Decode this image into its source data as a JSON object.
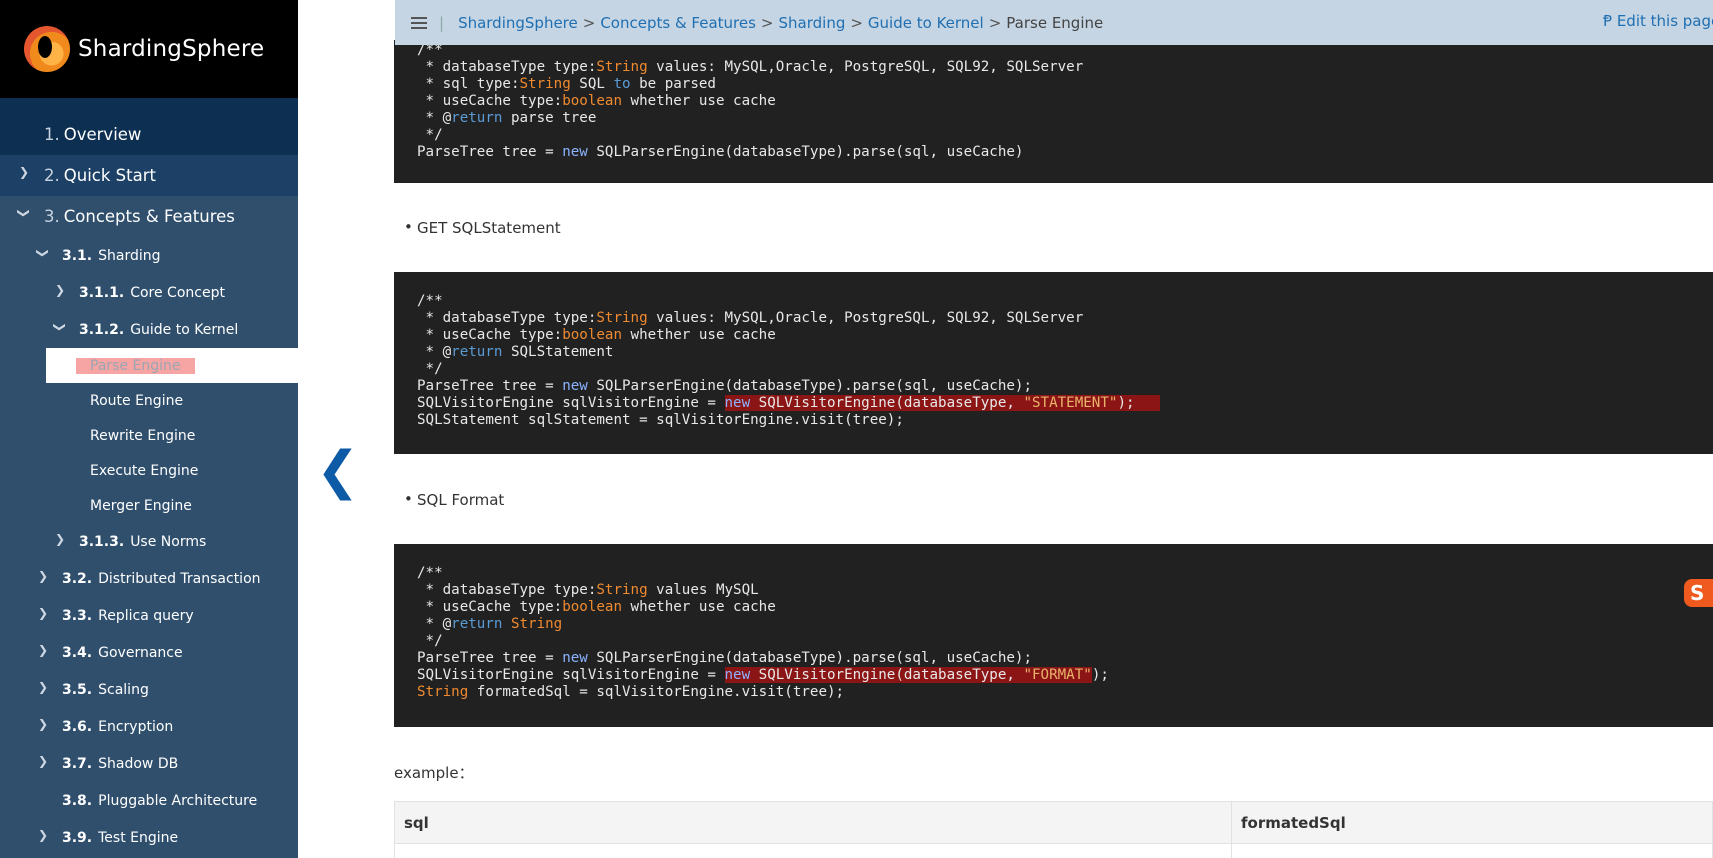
{
  "brand": {
    "name": "ShardingSphere"
  },
  "sidebar": {
    "items": [
      {
        "num": "1.",
        "label": "Overview"
      },
      {
        "num": "2.",
        "label": "Quick Start"
      },
      {
        "num": "3.",
        "label": "Concepts & Features"
      },
      {
        "num": "3.1.",
        "label": "Sharding"
      },
      {
        "num": "3.1.1.",
        "label": "Core Concept"
      },
      {
        "num": "3.1.2.",
        "label": "Guide to Kernel"
      },
      {
        "label": "Parse Engine"
      },
      {
        "label": "Route Engine"
      },
      {
        "label": "Rewrite Engine"
      },
      {
        "label": "Execute Engine"
      },
      {
        "label": "Merger Engine"
      },
      {
        "num": "3.1.3.",
        "label": "Use Norms"
      },
      {
        "num": "3.2.",
        "label": "Distributed Transaction"
      },
      {
        "num": "3.3.",
        "label": "Replica query"
      },
      {
        "num": "3.4.",
        "label": "Governance"
      },
      {
        "num": "3.5.",
        "label": "Scaling"
      },
      {
        "num": "3.6.",
        "label": "Encryption"
      },
      {
        "num": "3.7.",
        "label": "Shadow DB"
      },
      {
        "num": "3.8.",
        "label": "Pluggable Architecture"
      },
      {
        "num": "3.9.",
        "label": "Test Engine"
      }
    ]
  },
  "breadcrumb": {
    "items": [
      "ShardingSphere",
      "Concepts & Features",
      "Sharding",
      "Guide to Kernel"
    ],
    "separator": ">",
    "current": "Parse Engine"
  },
  "edit_link": "Edit this page",
  "bullets": [
    "GET SQLStatement",
    "SQL Format"
  ],
  "code_blocks": {
    "block1": {
      "l0": "/**",
      "l1a": " * databaseType type:",
      "l1b": "String",
      "l1c": " values: MySQL,Oracle, PostgreSQL, SQL92, SQLServer",
      "l2a": " * sql type:",
      "l2b": "String",
      "l2c": " SQL ",
      "l2d": "to",
      "l2e": " be parsed",
      "l3a": " * useCache type:",
      "l3b": "boolean",
      "l3c": " whether use cache",
      "l4a": " * @",
      "l4b": "return",
      "l4c": " parse tree",
      "l5": " */",
      "l6a": "ParseTree tree = ",
      "l6b": "new",
      "l6c": " SQLParserEngine(databaseType).parse(sql, useCache)"
    },
    "block2": {
      "l0": "/**",
      "l1a": " * databaseType type:",
      "l1b": "String",
      "l1c": " values: MySQL,Oracle, PostgreSQL, SQL92, SQLServer",
      "l2a": " * useCache type:",
      "l2b": "boolean",
      "l2c": " whether use cache",
      "l3a": " * @",
      "l3b": "return",
      "l3c": " SQLStatement",
      "l4": " */",
      "l5a": "ParseTree tree = ",
      "l5b": "new",
      "l5c": " SQLParserEngine(databaseType).parse(sql, useCache);",
      "l6a": "SQLVisitorEngine sqlVisitorEngine = ",
      "l6b": "new",
      "l6c": " SQLVisitorEngine(databaseType, ",
      "l6d": "\"STATEMENT\"",
      "l6e": ");",
      "l7": "SQLStatement sqlStatement = sqlVisitorEngine.visit(tree);"
    },
    "block3": {
      "l0": "/**",
      "l1a": " * databaseType type:",
      "l1b": "String",
      "l1c": " values MySQL",
      "l2a": " * useCache type:",
      "l2b": "boolean",
      "l2c": " whether use cache",
      "l3a": " * @",
      "l3b": "return",
      "l3c": " ",
      "l3d": "String",
      "l4": " */",
      "l5a": "ParseTree tree = ",
      "l5b": "new",
      "l5c": " SQLParserEngine(databaseType).parse(sql, useCache);",
      "l6a": "SQLVisitorEngine sqlVisitorEngine = ",
      "l6b": "new",
      "l6c": " SQLVisitorEngine(databaseType, ",
      "l6d": "\"FORMAT\"",
      "l6e": ");",
      "l7a": "String",
      "l7b": " formatedSql = sqlVisitorEngine.visit(tree);"
    }
  },
  "example": {
    "label": "example："
  },
  "table": {
    "headers": [
      "sql",
      "formatedSql"
    ]
  },
  "colors": {
    "sidebar_bg": "#2f4f6d",
    "sidebar_top": "#0d2f52",
    "code_bg": "#212121",
    "keyword": "#f08a2f",
    "link": "#1f6fb2",
    "highlight": "#8b1515"
  },
  "icons": [
    "menu-icon",
    "chevron-right-icon",
    "chevron-down-icon",
    "back-arrow-icon",
    "edit-icon",
    "sogou-icon"
  ]
}
